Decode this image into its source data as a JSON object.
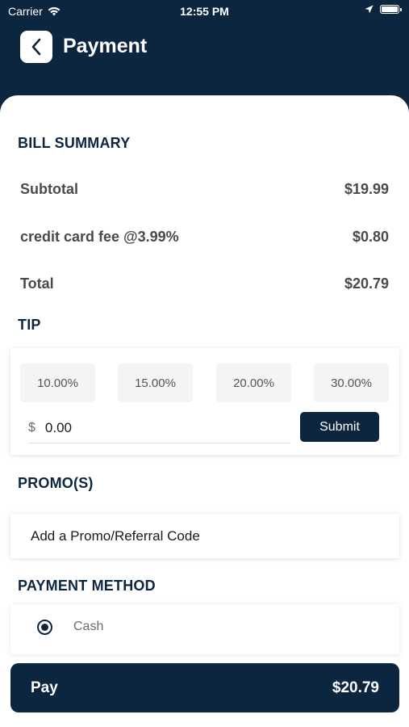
{
  "status_bar": {
    "carrier": "Carrier",
    "time": "12:55 PM"
  },
  "header": {
    "title": "Payment"
  },
  "bill_summary": {
    "title": "BILL SUMMARY",
    "rows": [
      {
        "label": "Subtotal",
        "value": "$19.99"
      },
      {
        "label": "credit card fee @3.99%",
        "value": "$0.80"
      },
      {
        "label": "Total",
        "value": "$20.79"
      }
    ]
  },
  "tip": {
    "title": "TIP",
    "options": [
      "10.00%",
      "15.00%",
      "20.00%",
      "30.00%"
    ],
    "currency_symbol": "$",
    "input_value": "0.00",
    "submit_label": "Submit"
  },
  "promo": {
    "title": "PROMO(S)",
    "add_label": "Add a Promo/Referral Code"
  },
  "payment_method": {
    "title": "PAYMENT METHOD",
    "options": [
      {
        "label": "Cash",
        "selected": true
      }
    ]
  },
  "pay_button": {
    "label": "Pay",
    "amount": "$20.79"
  },
  "colors": {
    "primary": "#0d2640",
    "chip_bg": "#f4f4f4"
  }
}
